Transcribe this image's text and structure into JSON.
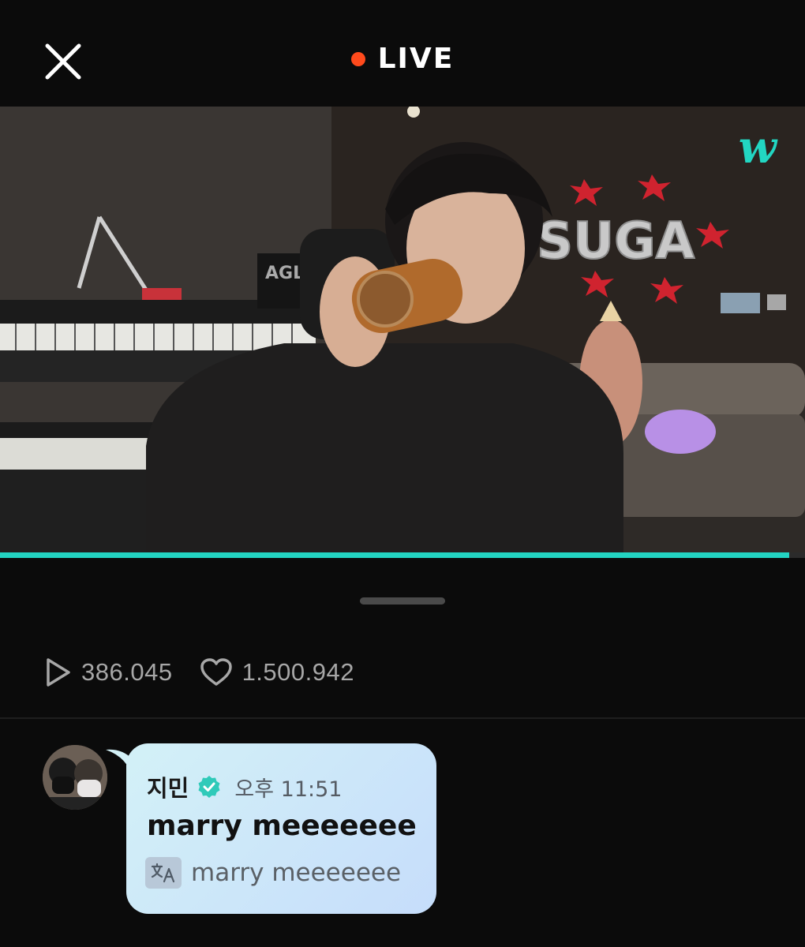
{
  "header": {
    "live_label": "LIVE",
    "close_icon": "close-icon",
    "live_dot_color": "#ff4a1c"
  },
  "video": {
    "brand_logo_text": "w",
    "balloon_text": "SUGA",
    "keyboard_label": "AGL",
    "progress_fraction": 0.98,
    "accent_color": "#23d4c2"
  },
  "stats": {
    "plays": "386.045",
    "likes": "1.500.942",
    "plays_icon": "play-icon",
    "likes_icon": "heart-icon"
  },
  "comment": {
    "author": "지민",
    "verified_icon": "verified-badge-icon",
    "time": "오후 11:51",
    "message": "marry meeeeeee",
    "translate_icon": "translate-icon",
    "translation": "marry meeeeeee"
  }
}
